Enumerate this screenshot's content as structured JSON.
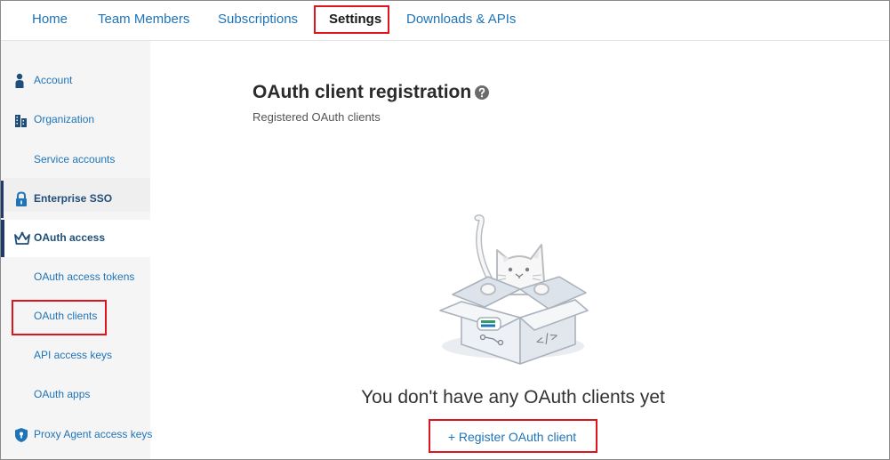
{
  "nav": {
    "tabs": [
      {
        "label": "Home"
      },
      {
        "label": "Team Members"
      },
      {
        "label": "Subscriptions"
      },
      {
        "label": "Settings"
      },
      {
        "label": "Downloads & APIs"
      }
    ],
    "active_tab": "Settings"
  },
  "sidebar": {
    "items": [
      {
        "label": "Account",
        "icon": "person-icon"
      },
      {
        "label": "Organization",
        "icon": "building-icon"
      },
      {
        "label": "Service accounts"
      },
      {
        "label": "Enterprise SSO",
        "icon": "lock-icon"
      },
      {
        "label": "OAuth access",
        "icon": "crown-icon"
      },
      {
        "label": "OAuth access tokens"
      },
      {
        "label": "OAuth clients"
      },
      {
        "label": "API access keys"
      },
      {
        "label": "OAuth apps"
      },
      {
        "label": "Proxy Agent access keys",
        "icon": "shield-icon"
      }
    ]
  },
  "main": {
    "title": "OAuth client registration",
    "subtitle": "Registered OAuth clients",
    "empty_message": "You don't have any OAuth clients yet",
    "register_button": "+ Register OAuth client"
  },
  "colors": {
    "link": "#1f74b7",
    "highlight": "#e0141e",
    "sidebar_bg": "#f5f5f5",
    "accent_bar": "#1f3a6b"
  }
}
